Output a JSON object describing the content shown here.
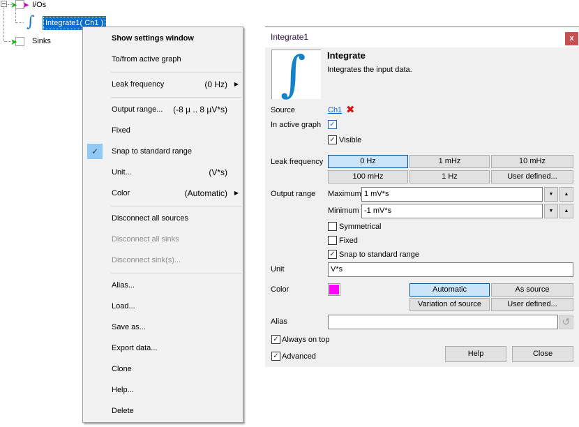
{
  "tree": {
    "ios_label": "I/Os",
    "selected_node_label": "Integrate1( Ch1 )",
    "sinks_label": "Sinks"
  },
  "context_menu": {
    "items": [
      {
        "label": "Show settings window",
        "value": "",
        "bold": true,
        "disabled": false
      },
      {
        "label": "To/from active graph",
        "value": ""
      },
      {
        "label": "Leak frequency",
        "value": "(0 Hz)",
        "submenu": true
      },
      {
        "label": "Output range...",
        "value": "(-8 µ .. 8 µV*s)"
      },
      {
        "label": "Fixed",
        "value": ""
      },
      {
        "label": "Snap to standard range",
        "value": "",
        "checked": true
      },
      {
        "label": "Unit...",
        "value": "(V*s)"
      },
      {
        "label": "Color",
        "value": "(Automatic)",
        "submenu": true
      },
      {
        "label": "Disconnect all sources",
        "value": ""
      },
      {
        "label": "Disconnect all sinks",
        "value": "",
        "disabled": true
      },
      {
        "label": "Disconnect sink(s)...",
        "value": "",
        "disabled": true
      },
      {
        "label": "Alias...",
        "value": ""
      },
      {
        "label": "Load...",
        "value": ""
      },
      {
        "label": "Save as...",
        "value": ""
      },
      {
        "label": "Export data...",
        "value": ""
      },
      {
        "label": "Clone",
        "value": ""
      },
      {
        "label": "Help...",
        "value": ""
      },
      {
        "label": "Delete",
        "value": ""
      }
    ],
    "check_glyph": "✓",
    "submenu_glyph": "▶"
  },
  "dialog": {
    "title": "Integrate1",
    "close_glyph": "x",
    "header_title": "Integrate",
    "header_description": "Integrates the input data.",
    "integral_glyph": "∫",
    "source": {
      "label": "Source",
      "link": "Ch1",
      "remove_glyph": "✖"
    },
    "in_active_graph": {
      "label": "In active graph",
      "checked": true
    },
    "visible": {
      "label": "Visible",
      "checked": true
    },
    "leak_frequency": {
      "label": "Leak frequency",
      "options": [
        "0 Hz",
        "1 mHz",
        "10 mHz",
        "100 mHz",
        "1 Hz",
        "User defined..."
      ],
      "selected": "0 Hz"
    },
    "output_range": {
      "label": "Output range",
      "maximum_label": "Maximum",
      "maximum_value": "1 mV*s",
      "minimum_label": "Minimum",
      "minimum_value": "-1 mV*s",
      "down_glyph": "▼",
      "up_glyph": "▲",
      "symmetrical": {
        "label": "Symmetrical",
        "checked": false
      },
      "fixed": {
        "label": "Fixed",
        "checked": false
      },
      "snap": {
        "label": "Snap to standard range",
        "checked": true
      }
    },
    "unit": {
      "label": "Unit",
      "value": "V*s"
    },
    "color": {
      "label": "Color",
      "swatch": "#ff00ff",
      "options": [
        "Automatic",
        "As source",
        "Variation of source",
        "User defined..."
      ],
      "selected": "Automatic"
    },
    "alias": {
      "label": "Alias",
      "value": "",
      "revert_glyph": "↺"
    },
    "always_on_top": {
      "label": "Always on top",
      "checked": true
    },
    "advanced": {
      "label": "Advanced",
      "checked": true
    },
    "help_button": "Help",
    "close_button": "Close",
    "check_glyph": "✓"
  }
}
